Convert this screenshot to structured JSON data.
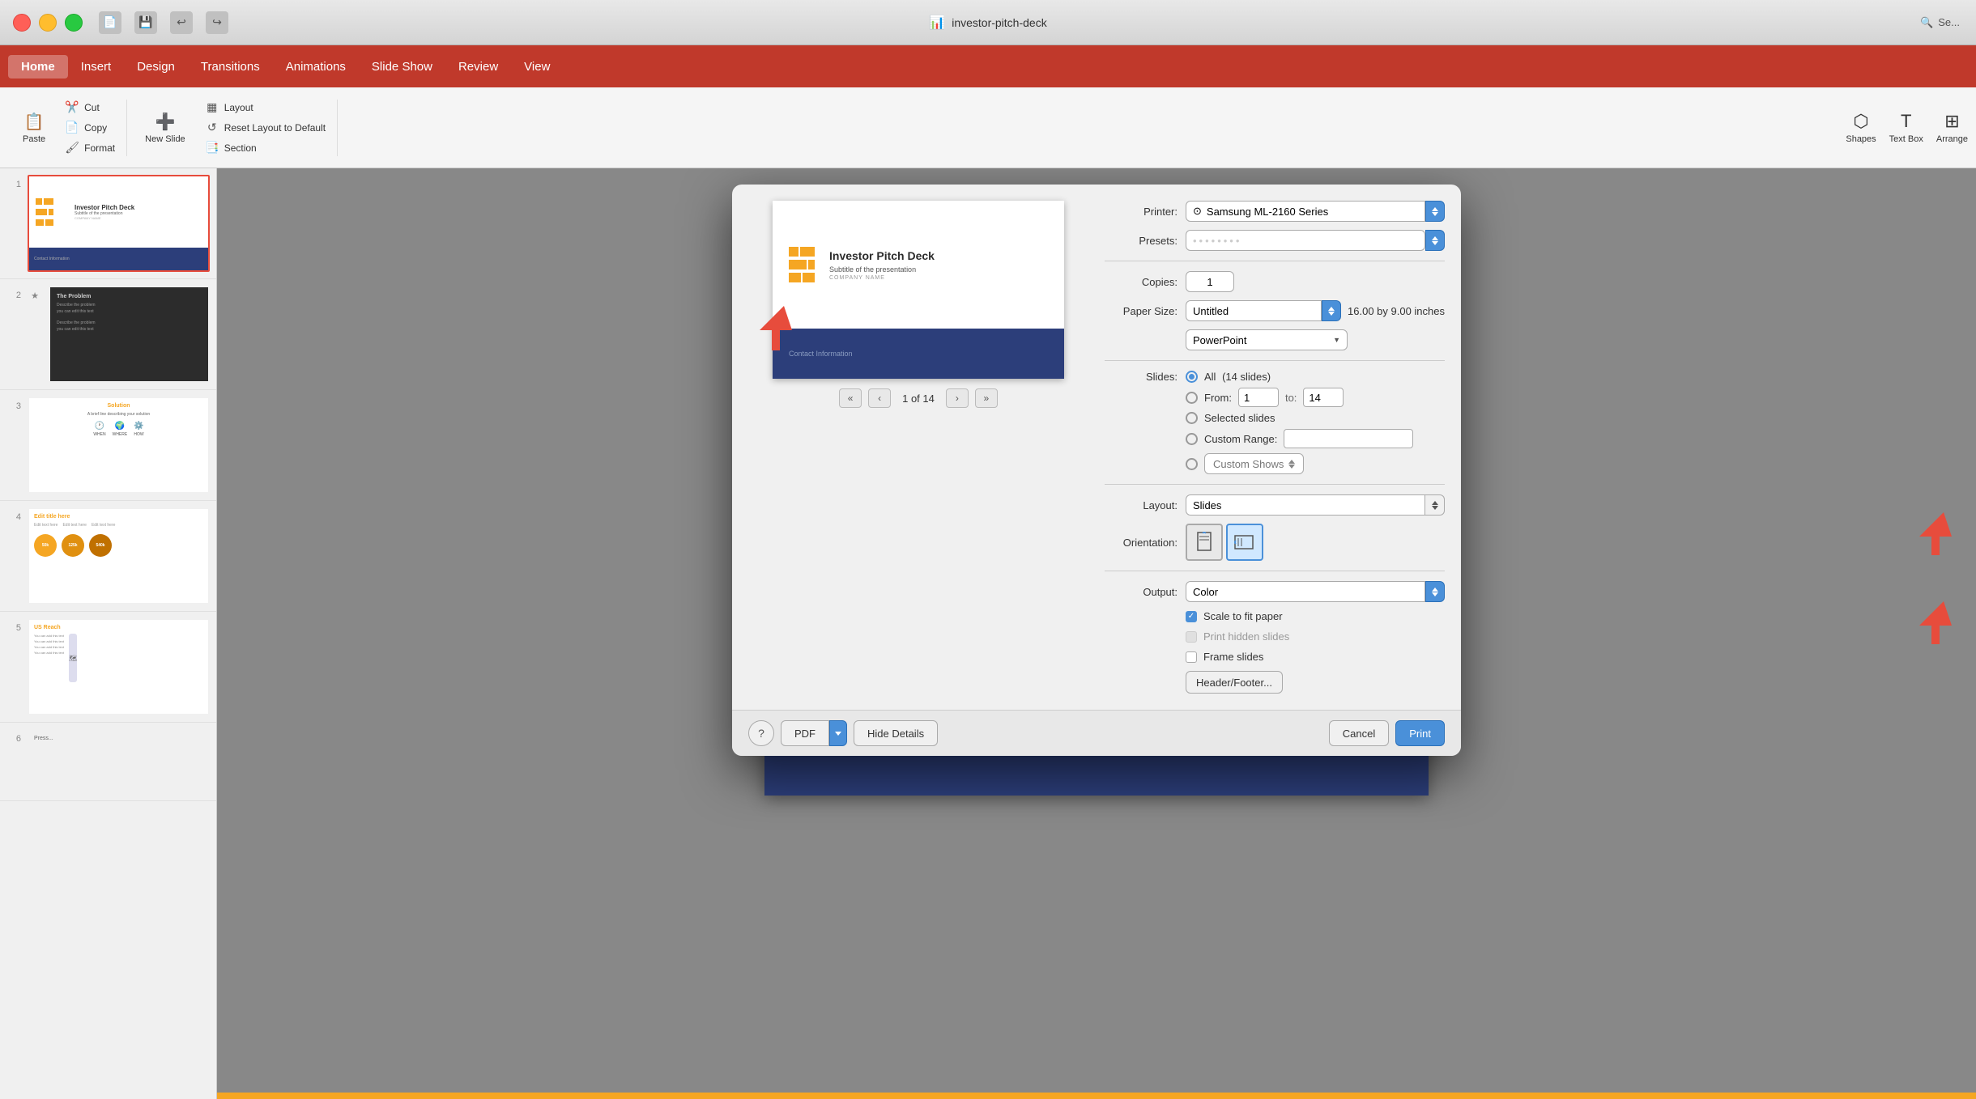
{
  "titlebar": {
    "title": "investor-pitch-deck",
    "title_icon": "📊"
  },
  "menubar": {
    "items": [
      {
        "id": "home",
        "label": "Home",
        "active": true
      },
      {
        "id": "insert",
        "label": "Insert",
        "active": false
      },
      {
        "id": "design",
        "label": "Design",
        "active": false
      },
      {
        "id": "transitions",
        "label": "Transitions",
        "active": false
      },
      {
        "id": "animations",
        "label": "Animations",
        "active": false
      },
      {
        "id": "slide_show",
        "label": "Slide Show",
        "active": false
      },
      {
        "id": "review",
        "label": "Review",
        "active": false
      },
      {
        "id": "view",
        "label": "View",
        "active": false
      }
    ]
  },
  "toolbar": {
    "paste_label": "Paste",
    "cut_label": "Cut",
    "copy_label": "Copy",
    "format_label": "Format",
    "new_slide_label": "New Slide",
    "layout_label": "Layout",
    "reset_label": "Reset Layout to Default",
    "section_label": "Section",
    "shapes_label": "Shapes",
    "text_box_label": "Text Box",
    "arrange_label": "Arrange"
  },
  "slide_panel": {
    "slides": [
      {
        "number": "1",
        "type": "title"
      },
      {
        "number": "2",
        "type": "problem"
      },
      {
        "number": "3",
        "type": "solution"
      },
      {
        "number": "4",
        "type": "metrics"
      },
      {
        "number": "5",
        "type": "us_reach"
      }
    ]
  },
  "canvas_slide": {
    "title": "Investor Pitch Deck",
    "subtitle": "Subtitle of the presentation",
    "company": "COMPANY NAME",
    "contact": "Contact Information"
  },
  "print_dialog": {
    "printer_label": "Printer:",
    "printer_value": "Samsung ML-2160 Series",
    "presets_label": "Presets:",
    "presets_value": "••••••••",
    "copies_label": "Copies:",
    "copies_value": "1",
    "paper_size_label": "Paper Size:",
    "paper_size_value": "Untitled",
    "paper_dimensions": "16.00 by 9.00 inches",
    "powerpoint_value": "PowerPoint",
    "slides_label": "Slides:",
    "slides_all_label": "All",
    "slides_all_count": "(14 slides)",
    "slides_from_label": "From:",
    "slides_from_value": "1",
    "slides_to_label": "to:",
    "slides_to_value": "14",
    "slides_selected_label": "Selected slides",
    "custom_range_label": "Custom Range:",
    "custom_shows_label": "Custom Shows",
    "layout_label": "Layout:",
    "layout_value": "Slides",
    "orientation_label": "Orientation:",
    "output_label": "Output:",
    "output_value": "Color",
    "scale_label": "Scale to fit paper",
    "print_hidden_label": "Print hidden slides",
    "frame_label": "Frame slides",
    "header_footer_btn": "Header/Footer...",
    "page_current": "1 of 14",
    "nav_first": "«",
    "nav_prev": "‹",
    "nav_next": "›",
    "nav_last": "»",
    "help_btn": "?",
    "pdf_btn": "PDF",
    "hide_details_btn": "Hide Details",
    "cancel_btn": "Cancel",
    "print_btn": "Print"
  }
}
